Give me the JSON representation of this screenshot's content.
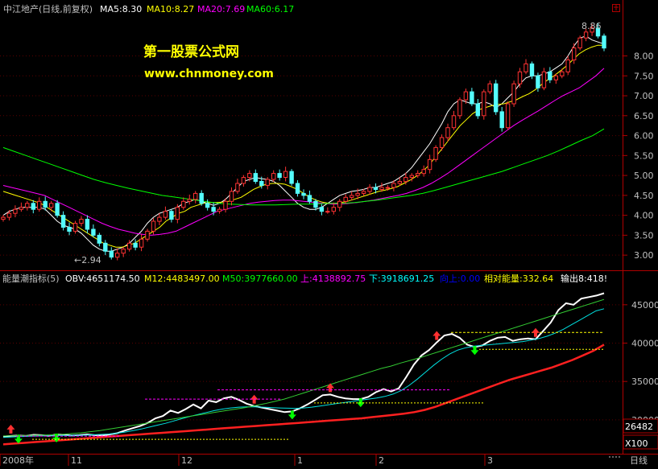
{
  "top_panel": {
    "title": "中江地产(日线,前复权)",
    "ma5": "MA5:8.30",
    "ma10": "MA10:8.27",
    "ma20": "MA20:7.69",
    "ma60": "MA60:6.17",
    "colors": {
      "ma5": "#ffffff",
      "ma10": "#ffff00",
      "ma20": "#ff00ff",
      "ma60": "#00ff00"
    }
  },
  "watermark": {
    "line1": "第一股票公式网",
    "line2": "www.chnmoney.com"
  },
  "price_annotations": {
    "low": "←2.94",
    "high": "8.86"
  },
  "bottom_panel": {
    "title": "能量潮指标(5)",
    "obv": "OBV:4651174.50",
    "m12": "M12:4483497.00",
    "m50": "M50:3977660.00",
    "up": "上:4138892.75",
    "down": "下:3918691.25",
    "up2": "向上:0.00",
    "relative": "相对能量:332.64",
    "output": "输出8:418!"
  },
  "right_box": {
    "value": "26482",
    "multiplier": "X100"
  },
  "x_axis": {
    "labels": [
      "2008年",
      "11",
      "12",
      "1",
      "2",
      "3"
    ],
    "period": "日线"
  },
  "chart_data": [
    {
      "type": "line",
      "title": "中江地产(日线,前复权)",
      "y_ticks": [
        3.0,
        3.5,
        4.0,
        4.5,
        5.0,
        5.5,
        6.0,
        6.5,
        7.0,
        7.5,
        8.0
      ],
      "ylim": [
        2.7,
        9.0
      ],
      "grid": false,
      "close": [
        3.95,
        4.05,
        4.15,
        4.2,
        4.3,
        4.15,
        4.35,
        4.2,
        4.3,
        4.0,
        3.7,
        3.6,
        3.8,
        3.9,
        3.65,
        3.5,
        3.3,
        3.1,
        2.95,
        3.05,
        3.15,
        3.3,
        3.2,
        3.4,
        3.6,
        3.85,
        3.95,
        4.1,
        3.9,
        4.2,
        4.35,
        4.4,
        4.55,
        4.3,
        4.2,
        4.1,
        4.15,
        4.35,
        4.6,
        4.8,
        4.95,
        5.05,
        4.85,
        4.75,
        4.9,
        5.05,
        4.95,
        5.1,
        4.8,
        4.55,
        4.5,
        4.35,
        4.2,
        4.1,
        4.1,
        4.2,
        4.35,
        4.45,
        4.5,
        4.55,
        4.6,
        4.7,
        4.65,
        4.7,
        4.7,
        4.8,
        4.85,
        4.95,
        5.0,
        5.05,
        5.15,
        5.4,
        5.7,
        5.95,
        6.2,
        6.5,
        6.9,
        7.1,
        6.8,
        6.5,
        7.1,
        7.3,
        6.6,
        6.2,
        6.8,
        7.3,
        7.6,
        7.8,
        7.5,
        7.2,
        7.6,
        7.4,
        7.5,
        7.6,
        7.9,
        8.2,
        8.45,
        8.6,
        8.7,
        8.5,
        8.2
      ],
      "series": [
        {
          "name": "MA5",
          "values": [
            4.0,
            4.1,
            4.15,
            4.2,
            4.2,
            4.2,
            4.2,
            4.15,
            4.0,
            3.85,
            3.75,
            3.7,
            3.65,
            3.55,
            3.4,
            3.25,
            3.15,
            3.1,
            3.1,
            3.15,
            3.2,
            3.3,
            3.45,
            3.6,
            3.8,
            3.95,
            4.05,
            4.1,
            4.15,
            4.2,
            4.3,
            4.35,
            4.4,
            4.35,
            4.3,
            4.25,
            4.3,
            4.4,
            4.55,
            4.7,
            4.85,
            4.9,
            4.95,
            4.92,
            4.9,
            4.85,
            4.75,
            4.6,
            4.45,
            4.3,
            4.2,
            4.15,
            4.15,
            4.2,
            4.3,
            4.4,
            4.5,
            4.55,
            4.6,
            4.62,
            4.65,
            4.7,
            4.7,
            4.75,
            4.8,
            4.85,
            4.95,
            5.05,
            5.2,
            5.4,
            5.6,
            5.8,
            6.05,
            6.3,
            6.6,
            6.8,
            6.9,
            6.85,
            6.8,
            6.8,
            6.85,
            6.8,
            6.7,
            6.8,
            6.95,
            7.1,
            7.3,
            7.45,
            7.5,
            7.5,
            7.55,
            7.6,
            7.7,
            7.8,
            8.0,
            8.25,
            8.45,
            8.5,
            8.4,
            8.35,
            8.3
          ]
        },
        {
          "name": "MA10",
          "values": [
            4.6,
            4.55,
            4.5,
            4.45,
            4.4,
            4.35,
            4.3,
            4.2,
            4.1,
            4.0,
            3.9,
            3.8,
            3.7,
            3.6,
            3.5,
            3.4,
            3.3,
            3.25,
            3.2,
            3.2,
            3.25,
            3.3,
            3.4,
            3.5,
            3.6,
            3.7,
            3.85,
            3.95,
            4.05,
            4.1,
            4.2,
            4.25,
            4.3,
            4.32,
            4.32,
            4.33,
            4.35,
            4.4,
            4.45,
            4.55,
            4.65,
            4.72,
            4.78,
            4.8,
            4.8,
            4.78,
            4.72,
            4.65,
            4.55,
            4.45,
            4.38,
            4.33,
            4.3,
            4.3,
            4.32,
            4.35,
            4.4,
            4.45,
            4.5,
            4.55,
            4.6,
            4.63,
            4.67,
            4.72,
            4.8,
            4.88,
            4.98,
            5.1,
            5.25,
            5.45,
            5.65,
            5.85,
            6.05,
            6.25,
            6.4,
            6.55,
            6.65,
            6.7,
            6.75,
            6.78,
            6.8,
            6.85,
            6.9,
            6.98,
            7.05,
            7.15,
            7.28,
            7.4,
            7.5,
            7.62,
            7.75,
            7.9,
            8.05,
            8.15,
            8.22,
            8.27,
            8.27
          ]
        },
        {
          "name": "MA20",
          "values": [
            4.75,
            4.7,
            4.65,
            4.6,
            4.55,
            4.5,
            4.4,
            4.3,
            4.2,
            4.1,
            4.0,
            3.9,
            3.8,
            3.72,
            3.65,
            3.6,
            3.55,
            3.52,
            3.5,
            3.52,
            3.55,
            3.6,
            3.7,
            3.8,
            3.9,
            4.0,
            4.1,
            4.15,
            4.2,
            4.25,
            4.3,
            4.33,
            4.35,
            4.37,
            4.38,
            4.38,
            4.36,
            4.34,
            4.32,
            4.3,
            4.28,
            4.28,
            4.3,
            4.32,
            4.35,
            4.38,
            4.42,
            4.46,
            4.5,
            4.55,
            4.62,
            4.7,
            4.8,
            4.92,
            5.05,
            5.2,
            5.35,
            5.5,
            5.65,
            5.8,
            5.95,
            6.1,
            6.25,
            6.38,
            6.5,
            6.62,
            6.75,
            6.88,
            7.0,
            7.1,
            7.2,
            7.35,
            7.5,
            7.69
          ]
        },
        {
          "name": "MA60",
          "values": [
            5.7,
            5.6,
            5.5,
            5.4,
            5.3,
            5.2,
            5.1,
            5.0,
            4.9,
            4.82,
            4.75,
            4.68,
            4.62,
            4.56,
            4.5,
            4.46,
            4.42,
            4.38,
            4.34,
            4.3,
            4.28,
            4.27,
            4.26,
            4.26,
            4.26,
            4.27,
            4.28,
            4.28,
            4.29,
            4.3,
            4.3,
            4.32,
            4.35,
            4.38,
            4.42,
            4.46,
            4.5,
            4.55,
            4.62,
            4.7,
            4.78,
            4.86,
            4.94,
            5.02,
            5.1,
            5.2,
            5.3,
            5.4,
            5.5,
            5.62,
            5.75,
            5.88,
            6.0,
            6.17
          ]
        }
      ],
      "annotations": [
        {
          "label": "←2.94",
          "value": 2.94
        },
        {
          "label": "8.86",
          "value": 8.86
        }
      ]
    },
    {
      "type": "line",
      "title": "能量潮指标(5)",
      "y_ticks": [
        30000,
        35000,
        40000,
        45000
      ],
      "ylim": [
        26000,
        47500
      ],
      "grid": false,
      "series": [
        {
          "name": "OBV",
          "values": [
            27800,
            27900,
            27950,
            27900,
            28050,
            28000,
            27900,
            28100,
            28050,
            27950,
            28000,
            28100,
            28000,
            27950,
            28100,
            28250,
            28600,
            28900,
            29200,
            29600,
            30200,
            30500,
            31200,
            30900,
            31400,
            32000,
            31500,
            32500,
            32300,
            32800,
            33000,
            32600,
            32100,
            31800,
            31600,
            31400,
            31200,
            31000,
            31100,
            31500,
            32000,
            32600,
            33200,
            33300,
            33000,
            32800,
            32700,
            32700,
            33000,
            33600,
            34000,
            33700,
            34100,
            35600,
            37200,
            38400,
            39100,
            40100,
            41000,
            41200,
            40700,
            39800,
            39500,
            39700,
            40300,
            40700,
            40800,
            40300,
            40500,
            40600,
            40500,
            41600,
            42700,
            44300,
            45200,
            45000,
            45800,
            46000,
            46200,
            46500
          ]
        },
        {
          "name": "M12",
          "values": [
            27700,
            27750,
            27800,
            27850,
            27880,
            27900,
            27920,
            27950,
            27970,
            27990,
            28000,
            28050,
            28100,
            28150,
            28250,
            28400,
            28600,
            28800,
            29050,
            29300,
            29550,
            29850,
            30150,
            30450,
            30700,
            30950,
            31200,
            31400,
            31550,
            31650,
            31700,
            31680,
            31650,
            31600,
            31550,
            31520,
            31500,
            31550,
            31650,
            31800,
            31950,
            32100,
            32250,
            32400,
            32550,
            32700,
            32850,
            33050,
            33350,
            33800,
            34500,
            35300,
            36200,
            37100,
            37900,
            38600,
            39100,
            39400,
            39600,
            39700,
            39800,
            39900,
            40000,
            40100,
            40200,
            40400,
            40600,
            40900,
            41300,
            41800,
            42400,
            43000,
            43600,
            44200,
            44484
          ]
        },
        {
          "name": "M50",
          "values": [
            27900,
            27920,
            27950,
            27980,
            28000,
            28050,
            28100,
            28200,
            28300,
            28450,
            28600,
            28800,
            29000,
            29200,
            29400,
            29600,
            29800,
            30000,
            30200,
            30400,
            30600,
            30800,
            31000,
            31200,
            31400,
            31600,
            31850,
            32100,
            32400,
            32700,
            33100,
            33500,
            33900,
            34300,
            34700,
            35100,
            35500,
            35900,
            36300,
            36700,
            37000,
            37400,
            37750,
            38100,
            38500,
            38900,
            39300,
            39700,
            40100,
            40500,
            40900,
            41300,
            41700,
            42100,
            42500,
            42900,
            43300,
            43700,
            44100,
            44500,
            44900,
            45300,
            45700
          ]
        },
        {
          "name": "MA",
          "values": [
            26800,
            26900,
            27000,
            27100,
            27200,
            27300,
            27400,
            27500,
            27600,
            27700,
            27800,
            27900,
            28000,
            28100,
            28200,
            28300,
            28400,
            28500,
            28600,
            28700,
            28800,
            28900,
            29000,
            29100,
            29200,
            29300,
            29400,
            29500,
            29600,
            29700,
            29800,
            29900,
            30000,
            30100,
            30200,
            30350,
            30500,
            30650,
            30800,
            31000,
            31300,
            31700,
            32200,
            32700,
            33200,
            33700,
            34200,
            34700,
            35200,
            35600,
            36000,
            36400,
            36800,
            37300,
            37800,
            38400,
            39000,
            39800
          ]
        }
      ],
      "up_level": 41388.9275,
      "down_level": 39186.9125
    }
  ]
}
